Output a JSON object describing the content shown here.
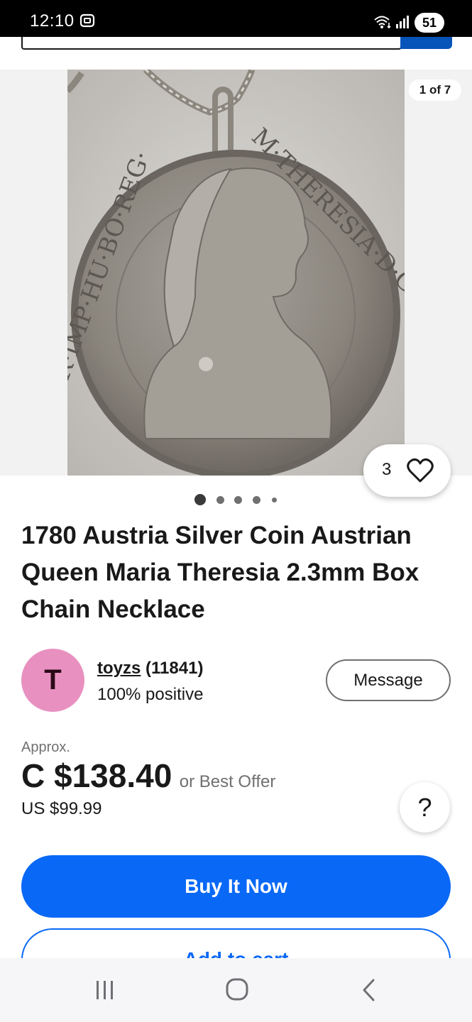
{
  "status_bar": {
    "time": "12:10",
    "battery": "51",
    "icons": [
      "screenshot-icon",
      "wifi-icon",
      "signal-icon"
    ]
  },
  "gallery": {
    "counter": "1 of 7",
    "watch_count": "3",
    "dots_count": 5,
    "active_dot": 0,
    "image_description_icon": "coin-necklace-photo"
  },
  "listing": {
    "title": "1780 Austria Silver Coin Austrian Queen Maria Theresia 2.3mm Box Chain Necklace"
  },
  "seller": {
    "avatar_letter": "T",
    "avatar_color": "#e891c0",
    "name": "toyzs",
    "feedback_count": "(11841)",
    "positive": "100% positive",
    "message_label": "Message"
  },
  "price": {
    "approx_label": "Approx.",
    "main": "C $138.40",
    "best_offer": "or Best Offer",
    "us_price": "US $99.99",
    "help_label": "?"
  },
  "actions": {
    "buy_label": "Buy It Now",
    "cart_label": "Add to cart"
  },
  "colors": {
    "accent_blue": "#0968f6",
    "search_button": "#0654ba"
  }
}
